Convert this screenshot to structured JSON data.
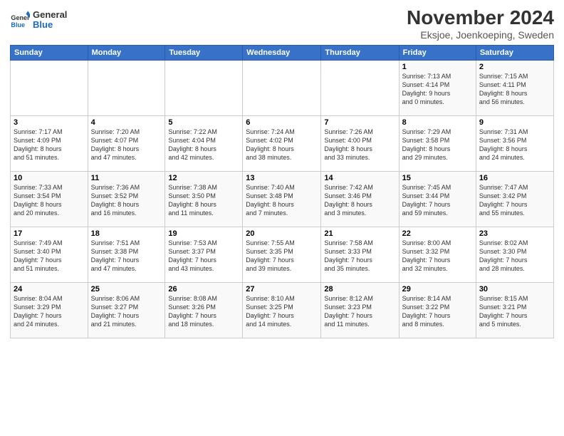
{
  "logo": {
    "line1": "General",
    "line2": "Blue"
  },
  "title": "November 2024",
  "subtitle": "Eksjoe, Joenkoeping, Sweden",
  "days_of_week": [
    "Sunday",
    "Monday",
    "Tuesday",
    "Wednesday",
    "Thursday",
    "Friday",
    "Saturday"
  ],
  "weeks": [
    [
      {
        "day": "",
        "info": ""
      },
      {
        "day": "",
        "info": ""
      },
      {
        "day": "",
        "info": ""
      },
      {
        "day": "",
        "info": ""
      },
      {
        "day": "",
        "info": ""
      },
      {
        "day": "1",
        "info": "Sunrise: 7:13 AM\nSunset: 4:14 PM\nDaylight: 9 hours\nand 0 minutes."
      },
      {
        "day": "2",
        "info": "Sunrise: 7:15 AM\nSunset: 4:11 PM\nDaylight: 8 hours\nand 56 minutes."
      }
    ],
    [
      {
        "day": "3",
        "info": "Sunrise: 7:17 AM\nSunset: 4:09 PM\nDaylight: 8 hours\nand 51 minutes."
      },
      {
        "day": "4",
        "info": "Sunrise: 7:20 AM\nSunset: 4:07 PM\nDaylight: 8 hours\nand 47 minutes."
      },
      {
        "day": "5",
        "info": "Sunrise: 7:22 AM\nSunset: 4:04 PM\nDaylight: 8 hours\nand 42 minutes."
      },
      {
        "day": "6",
        "info": "Sunrise: 7:24 AM\nSunset: 4:02 PM\nDaylight: 8 hours\nand 38 minutes."
      },
      {
        "day": "7",
        "info": "Sunrise: 7:26 AM\nSunset: 4:00 PM\nDaylight: 8 hours\nand 33 minutes."
      },
      {
        "day": "8",
        "info": "Sunrise: 7:29 AM\nSunset: 3:58 PM\nDaylight: 8 hours\nand 29 minutes."
      },
      {
        "day": "9",
        "info": "Sunrise: 7:31 AM\nSunset: 3:56 PM\nDaylight: 8 hours\nand 24 minutes."
      }
    ],
    [
      {
        "day": "10",
        "info": "Sunrise: 7:33 AM\nSunset: 3:54 PM\nDaylight: 8 hours\nand 20 minutes."
      },
      {
        "day": "11",
        "info": "Sunrise: 7:36 AM\nSunset: 3:52 PM\nDaylight: 8 hours\nand 16 minutes."
      },
      {
        "day": "12",
        "info": "Sunrise: 7:38 AM\nSunset: 3:50 PM\nDaylight: 8 hours\nand 11 minutes."
      },
      {
        "day": "13",
        "info": "Sunrise: 7:40 AM\nSunset: 3:48 PM\nDaylight: 8 hours\nand 7 minutes."
      },
      {
        "day": "14",
        "info": "Sunrise: 7:42 AM\nSunset: 3:46 PM\nDaylight: 8 hours\nand 3 minutes."
      },
      {
        "day": "15",
        "info": "Sunrise: 7:45 AM\nSunset: 3:44 PM\nDaylight: 7 hours\nand 59 minutes."
      },
      {
        "day": "16",
        "info": "Sunrise: 7:47 AM\nSunset: 3:42 PM\nDaylight: 7 hours\nand 55 minutes."
      }
    ],
    [
      {
        "day": "17",
        "info": "Sunrise: 7:49 AM\nSunset: 3:40 PM\nDaylight: 7 hours\nand 51 minutes."
      },
      {
        "day": "18",
        "info": "Sunrise: 7:51 AM\nSunset: 3:38 PM\nDaylight: 7 hours\nand 47 minutes."
      },
      {
        "day": "19",
        "info": "Sunrise: 7:53 AM\nSunset: 3:37 PM\nDaylight: 7 hours\nand 43 minutes."
      },
      {
        "day": "20",
        "info": "Sunrise: 7:55 AM\nSunset: 3:35 PM\nDaylight: 7 hours\nand 39 minutes."
      },
      {
        "day": "21",
        "info": "Sunrise: 7:58 AM\nSunset: 3:33 PM\nDaylight: 7 hours\nand 35 minutes."
      },
      {
        "day": "22",
        "info": "Sunrise: 8:00 AM\nSunset: 3:32 PM\nDaylight: 7 hours\nand 32 minutes."
      },
      {
        "day": "23",
        "info": "Sunrise: 8:02 AM\nSunset: 3:30 PM\nDaylight: 7 hours\nand 28 minutes."
      }
    ],
    [
      {
        "day": "24",
        "info": "Sunrise: 8:04 AM\nSunset: 3:29 PM\nDaylight: 7 hours\nand 24 minutes."
      },
      {
        "day": "25",
        "info": "Sunrise: 8:06 AM\nSunset: 3:27 PM\nDaylight: 7 hours\nand 21 minutes."
      },
      {
        "day": "26",
        "info": "Sunrise: 8:08 AM\nSunset: 3:26 PM\nDaylight: 7 hours\nand 18 minutes."
      },
      {
        "day": "27",
        "info": "Sunrise: 8:10 AM\nSunset: 3:25 PM\nDaylight: 7 hours\nand 14 minutes."
      },
      {
        "day": "28",
        "info": "Sunrise: 8:12 AM\nSunset: 3:23 PM\nDaylight: 7 hours\nand 11 minutes."
      },
      {
        "day": "29",
        "info": "Sunrise: 8:14 AM\nSunset: 3:22 PM\nDaylight: 7 hours\nand 8 minutes."
      },
      {
        "day": "30",
        "info": "Sunrise: 8:15 AM\nSunset: 3:21 PM\nDaylight: 7 hours\nand 5 minutes."
      }
    ]
  ]
}
